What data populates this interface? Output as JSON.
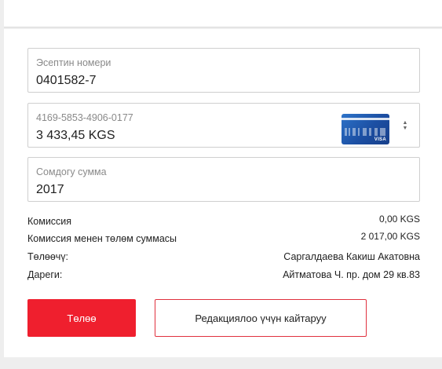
{
  "form": {
    "account": {
      "label": "Эсептин номери",
      "value": "0401582-7"
    },
    "card": {
      "label": "4169-5853-4906-0177",
      "value": "3 433,45 KGS",
      "brand": "VISA",
      "arrows": "▲▼"
    },
    "amount": {
      "label": "Сомдогу сумма",
      "value": "2017"
    }
  },
  "summary": {
    "fee": {
      "label": "Комиссия",
      "value": "0,00 KGS"
    },
    "total": {
      "label": "Комиссия менен төлөм суммасы",
      "value": "2 017,00 KGS"
    },
    "payer": {
      "label": "Төлөөчү:",
      "value": "Саргалдаева Какиш Акатовна"
    },
    "address": {
      "label": "Дареги:",
      "value": "Айтматова Ч. пр. дом 29 кв.83"
    }
  },
  "buttons": {
    "pay": "Төлөө",
    "back": "Редакциялоо үчүн кайтаруу"
  },
  "colors": {
    "accent": "#ef1f2e",
    "card_blue": "#1c4fa3"
  }
}
